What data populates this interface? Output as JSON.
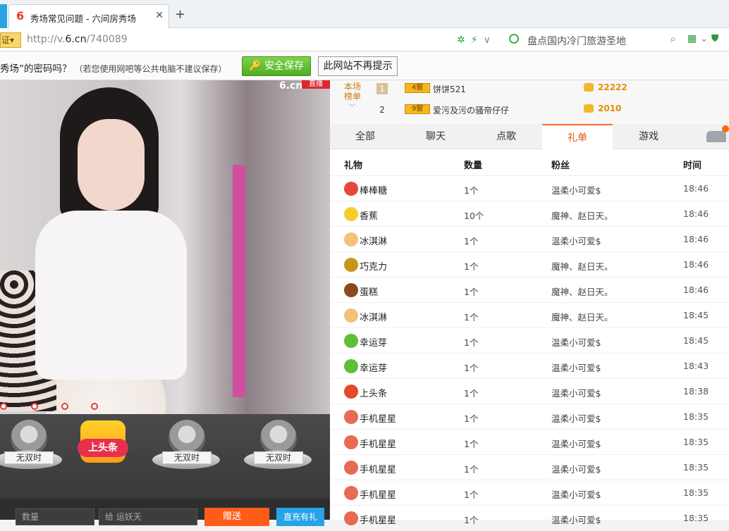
{
  "browser": {
    "tab_title": "秀场常见问题 - 六间房秀场",
    "tab_close": "✕",
    "new_tab": "+",
    "cert_label": "证",
    "url_prefix": "http://v.",
    "url_domain": "6.cn",
    "url_path": "/740089",
    "search_text": "盘点国内冷门旅游圣地"
  },
  "password_bar": {
    "message": "秀场”的密码吗？",
    "note": "（若您使用网吧等公共电脑不建议保存）",
    "save_label": "安全保存",
    "never_label": "此网站不再提示"
  },
  "video": {
    "logo": "6.cn",
    "live_badge": "直播"
  },
  "bottom": {
    "avatars": [
      {
        "name": "无双时"
      },
      {
        "name": "无双时"
      },
      {
        "name": "无双时"
      }
    ],
    "headline_label": "上头条",
    "qty_placeholder": "数量",
    "to_label": "给 运妖天",
    "send_label": "赠送",
    "recharge_label": "直充有礼"
  },
  "ranking": {
    "label": "本场榜单",
    "rows": [
      {
        "rank": "1",
        "level": "4窗",
        "name": "饼饼521",
        "value": "22222"
      },
      {
        "rank": "2",
        "level": "9窗",
        "name": "爱污及污の骚帝仔仔",
        "value": "2010"
      }
    ]
  },
  "tabs": [
    "全部",
    "聊天",
    "点歌",
    "礼单",
    "游戏"
  ],
  "active_tab": "礼单",
  "gift_table": {
    "headers": {
      "gift": "礼物",
      "qty": "数量",
      "fan": "粉丝",
      "time": "时间"
    },
    "rows": [
      {
        "gift": "棒棒糖",
        "qty": "1个",
        "fan": "温柔小可爱$",
        "time": "18:46",
        "color": "#e8453c"
      },
      {
        "gift": "香蕉",
        "qty": "10个",
        "fan": "魔神、赵日天。",
        "time": "18:46",
        "color": "#f4cf2c"
      },
      {
        "gift": "冰淇淋",
        "qty": "1个",
        "fan": "温柔小可爱$",
        "time": "18:46",
        "color": "#f3c27a"
      },
      {
        "gift": "巧克力",
        "qty": "1个",
        "fan": "魔神、赵日天。",
        "time": "18:46",
        "color": "#c7951a"
      },
      {
        "gift": "蛋糕",
        "qty": "1个",
        "fan": "魔神、赵日天。",
        "time": "18:46",
        "color": "#8a4a1c"
      },
      {
        "gift": "冰淇淋",
        "qty": "1个",
        "fan": "魔神、赵日天。",
        "time": "18:45",
        "color": "#f3c27a"
      },
      {
        "gift": "幸运芽",
        "qty": "1个",
        "fan": "温柔小可爱$",
        "time": "18:45",
        "color": "#5fbf36"
      },
      {
        "gift": "幸运芽",
        "qty": "1个",
        "fan": "温柔小可爱$",
        "time": "18:43",
        "color": "#5fbf36"
      },
      {
        "gift": "上头条",
        "qty": "1个",
        "fan": "温柔小可爱$",
        "time": "18:38",
        "color": "#e34a2a"
      },
      {
        "gift": "手机星星",
        "qty": "1个",
        "fan": "温柔小可爱$",
        "time": "18:35",
        "color": "#e86a54"
      },
      {
        "gift": "手机星星",
        "qty": "1个",
        "fan": "温柔小可爱$",
        "time": "18:35",
        "color": "#e86a54"
      },
      {
        "gift": "手机星星",
        "qty": "1个",
        "fan": "温柔小可爱$",
        "time": "18:35",
        "color": "#e86a54"
      },
      {
        "gift": "手机星星",
        "qty": "1个",
        "fan": "温柔小可爱$",
        "time": "18:35",
        "color": "#e86a54"
      },
      {
        "gift": "手机星星",
        "qty": "1个",
        "fan": "温柔小可爱$",
        "time": "18:35",
        "color": "#e86a54"
      }
    ]
  }
}
